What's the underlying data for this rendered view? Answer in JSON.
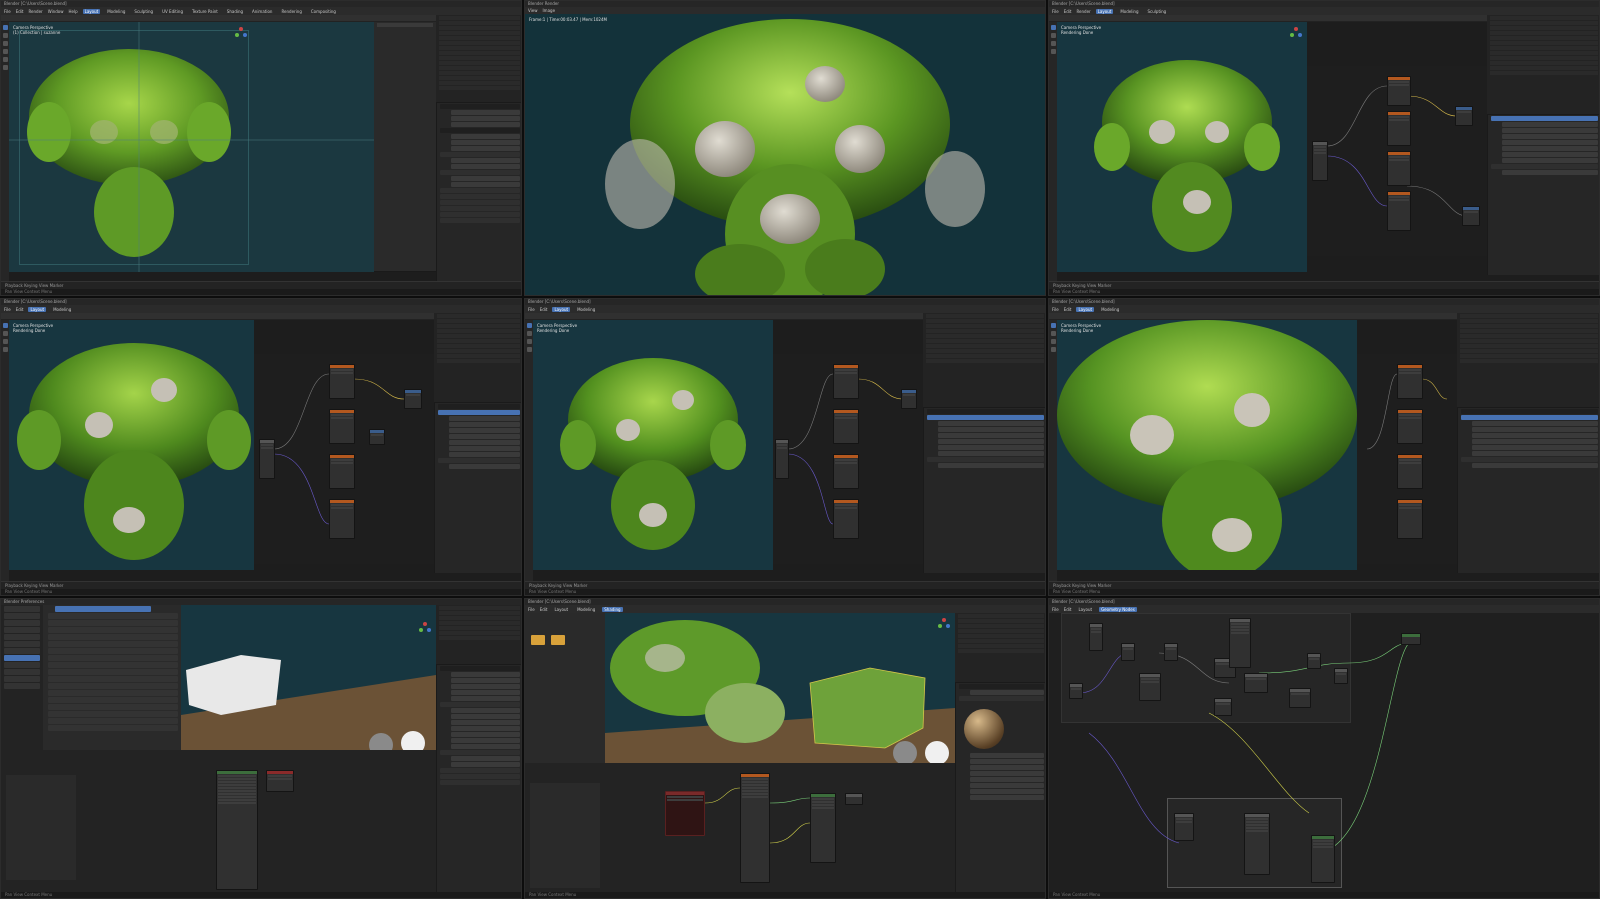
{
  "app": {
    "name": "Blender",
    "workspaces": [
      "Layout",
      "Modeling",
      "Sculpting",
      "UV Editing",
      "Texture Paint",
      "Shading",
      "Animation",
      "Rendering",
      "Compositing",
      "Geometry Nodes",
      "Scripting"
    ],
    "active_workspace": "Layout",
    "menus": [
      "File",
      "Edit",
      "Render",
      "Window",
      "Help"
    ]
  },
  "panels": [
    {
      "id": "p1",
      "title": "Blender [C:\\Users\\Scene.blend]",
      "viewport_label": "Camera Perspective\n(1) Collection | suzanne"
    },
    {
      "id": "p2",
      "title": "Blender Render",
      "viewport_label": "Frame:1 | Time:00:03.47 | Mem:1024M"
    },
    {
      "id": "p3",
      "title": "Blender [C:\\Users\\Scene.blend]",
      "viewport_label": "Camera Perspective\nRendering Done"
    },
    {
      "id": "p4",
      "title": "Blender [C:\\Users\\Scene.blend]",
      "viewport_label": "Camera Perspective\nRendering Done"
    },
    {
      "id": "p5",
      "title": "Blender [C:\\Users\\Scene.blend]",
      "viewport_label": "Camera Perspective\nRendering Done"
    },
    {
      "id": "p6",
      "title": "Blender [C:\\Users\\Scene.blend]",
      "viewport_label": "Camera Perspective\nRendering Done"
    },
    {
      "id": "p7",
      "title": "Blender Preferences",
      "viewport_label": ""
    },
    {
      "id": "p8",
      "title": "Blender [C:\\Users\\Scene.blend]",
      "viewport_label": ""
    },
    {
      "id": "p9",
      "title": "Blender [C:\\Users\\Scene.blend]",
      "viewport_label": ""
    }
  ],
  "timeline": {
    "label": "Playback   Keying   View   Marker"
  },
  "status": {
    "label": "Pan View   Context Menu"
  },
  "colors": {
    "accent": "#4772b3",
    "viewport_bg": "#1c3a40",
    "moss_dark": "#3f6e1e",
    "moss_light": "#8fc23a",
    "stone": "#b9b2a4"
  },
  "icons": [
    "move-icon",
    "rotate-icon",
    "scale-icon",
    "cursor-icon",
    "annotate-icon",
    "measure-icon"
  ]
}
